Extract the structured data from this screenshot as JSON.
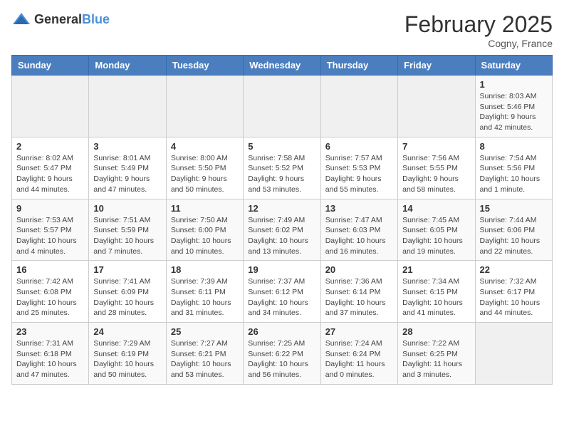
{
  "logo": {
    "general": "General",
    "blue": "Blue"
  },
  "header": {
    "month": "February 2025",
    "location": "Cogny, France"
  },
  "weekdays": [
    "Sunday",
    "Monday",
    "Tuesday",
    "Wednesday",
    "Thursday",
    "Friday",
    "Saturday"
  ],
  "weeks": [
    [
      {
        "day": "",
        "info": ""
      },
      {
        "day": "",
        "info": ""
      },
      {
        "day": "",
        "info": ""
      },
      {
        "day": "",
        "info": ""
      },
      {
        "day": "",
        "info": ""
      },
      {
        "day": "",
        "info": ""
      },
      {
        "day": "1",
        "info": "Sunrise: 8:03 AM\nSunset: 5:46 PM\nDaylight: 9 hours and 42 minutes."
      }
    ],
    [
      {
        "day": "2",
        "info": "Sunrise: 8:02 AM\nSunset: 5:47 PM\nDaylight: 9 hours and 44 minutes."
      },
      {
        "day": "3",
        "info": "Sunrise: 8:01 AM\nSunset: 5:49 PM\nDaylight: 9 hours and 47 minutes."
      },
      {
        "day": "4",
        "info": "Sunrise: 8:00 AM\nSunset: 5:50 PM\nDaylight: 9 hours and 50 minutes."
      },
      {
        "day": "5",
        "info": "Sunrise: 7:58 AM\nSunset: 5:52 PM\nDaylight: 9 hours and 53 minutes."
      },
      {
        "day": "6",
        "info": "Sunrise: 7:57 AM\nSunset: 5:53 PM\nDaylight: 9 hours and 55 minutes."
      },
      {
        "day": "7",
        "info": "Sunrise: 7:56 AM\nSunset: 5:55 PM\nDaylight: 9 hours and 58 minutes."
      },
      {
        "day": "8",
        "info": "Sunrise: 7:54 AM\nSunset: 5:56 PM\nDaylight: 10 hours and 1 minute."
      }
    ],
    [
      {
        "day": "9",
        "info": "Sunrise: 7:53 AM\nSunset: 5:57 PM\nDaylight: 10 hours and 4 minutes."
      },
      {
        "day": "10",
        "info": "Sunrise: 7:51 AM\nSunset: 5:59 PM\nDaylight: 10 hours and 7 minutes."
      },
      {
        "day": "11",
        "info": "Sunrise: 7:50 AM\nSunset: 6:00 PM\nDaylight: 10 hours and 10 minutes."
      },
      {
        "day": "12",
        "info": "Sunrise: 7:49 AM\nSunset: 6:02 PM\nDaylight: 10 hours and 13 minutes."
      },
      {
        "day": "13",
        "info": "Sunrise: 7:47 AM\nSunset: 6:03 PM\nDaylight: 10 hours and 16 minutes."
      },
      {
        "day": "14",
        "info": "Sunrise: 7:45 AM\nSunset: 6:05 PM\nDaylight: 10 hours and 19 minutes."
      },
      {
        "day": "15",
        "info": "Sunrise: 7:44 AM\nSunset: 6:06 PM\nDaylight: 10 hours and 22 minutes."
      }
    ],
    [
      {
        "day": "16",
        "info": "Sunrise: 7:42 AM\nSunset: 6:08 PM\nDaylight: 10 hours and 25 minutes."
      },
      {
        "day": "17",
        "info": "Sunrise: 7:41 AM\nSunset: 6:09 PM\nDaylight: 10 hours and 28 minutes."
      },
      {
        "day": "18",
        "info": "Sunrise: 7:39 AM\nSunset: 6:11 PM\nDaylight: 10 hours and 31 minutes."
      },
      {
        "day": "19",
        "info": "Sunrise: 7:37 AM\nSunset: 6:12 PM\nDaylight: 10 hours and 34 minutes."
      },
      {
        "day": "20",
        "info": "Sunrise: 7:36 AM\nSunset: 6:14 PM\nDaylight: 10 hours and 37 minutes."
      },
      {
        "day": "21",
        "info": "Sunrise: 7:34 AM\nSunset: 6:15 PM\nDaylight: 10 hours and 41 minutes."
      },
      {
        "day": "22",
        "info": "Sunrise: 7:32 AM\nSunset: 6:17 PM\nDaylight: 10 hours and 44 minutes."
      }
    ],
    [
      {
        "day": "23",
        "info": "Sunrise: 7:31 AM\nSunset: 6:18 PM\nDaylight: 10 hours and 47 minutes."
      },
      {
        "day": "24",
        "info": "Sunrise: 7:29 AM\nSunset: 6:19 PM\nDaylight: 10 hours and 50 minutes."
      },
      {
        "day": "25",
        "info": "Sunrise: 7:27 AM\nSunset: 6:21 PM\nDaylight: 10 hours and 53 minutes."
      },
      {
        "day": "26",
        "info": "Sunrise: 7:25 AM\nSunset: 6:22 PM\nDaylight: 10 hours and 56 minutes."
      },
      {
        "day": "27",
        "info": "Sunrise: 7:24 AM\nSunset: 6:24 PM\nDaylight: 11 hours and 0 minutes."
      },
      {
        "day": "28",
        "info": "Sunrise: 7:22 AM\nSunset: 6:25 PM\nDaylight: 11 hours and 3 minutes."
      },
      {
        "day": "",
        "info": ""
      }
    ]
  ]
}
